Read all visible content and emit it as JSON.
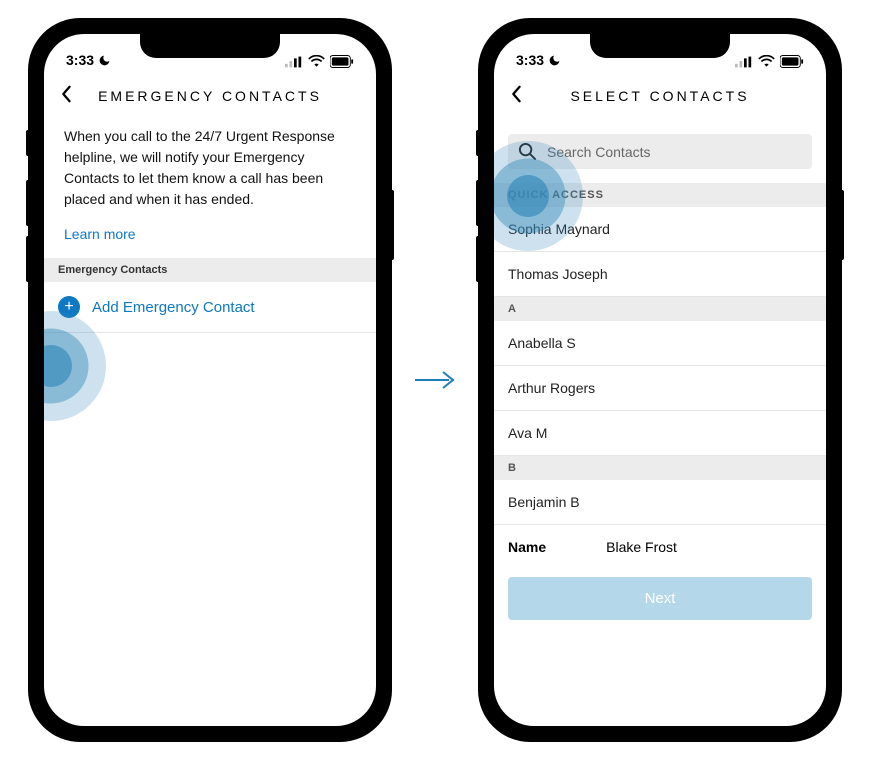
{
  "status": {
    "time": "3:33"
  },
  "left": {
    "header_title": "EMERGENCY CONTACTS",
    "intro": "When you call to the 24/7 Urgent Response helpline, we will notify your Emergency Contacts to let them know a call has been placed and when it has ended.",
    "learn_more": "Learn more",
    "section_header": "Emergency Contacts",
    "add_label": "Add Emergency Contact"
  },
  "right": {
    "header_title": "SELECT CONTACTS",
    "search_placeholder": "Search Contacts",
    "quick_access_header": "QUICK ACCESS",
    "quick": [
      {
        "name": "Sophia Maynard"
      },
      {
        "name": "Thomas Joseph"
      }
    ],
    "sections": [
      {
        "letter": "A",
        "items": [
          "Anabella S",
          "Arthur Rogers",
          "Ava M"
        ]
      },
      {
        "letter": "B",
        "items": [
          "Benjamin B"
        ]
      }
    ],
    "detail_key": "Name",
    "detail_value": "Blake Frost",
    "next_label": "Next"
  }
}
